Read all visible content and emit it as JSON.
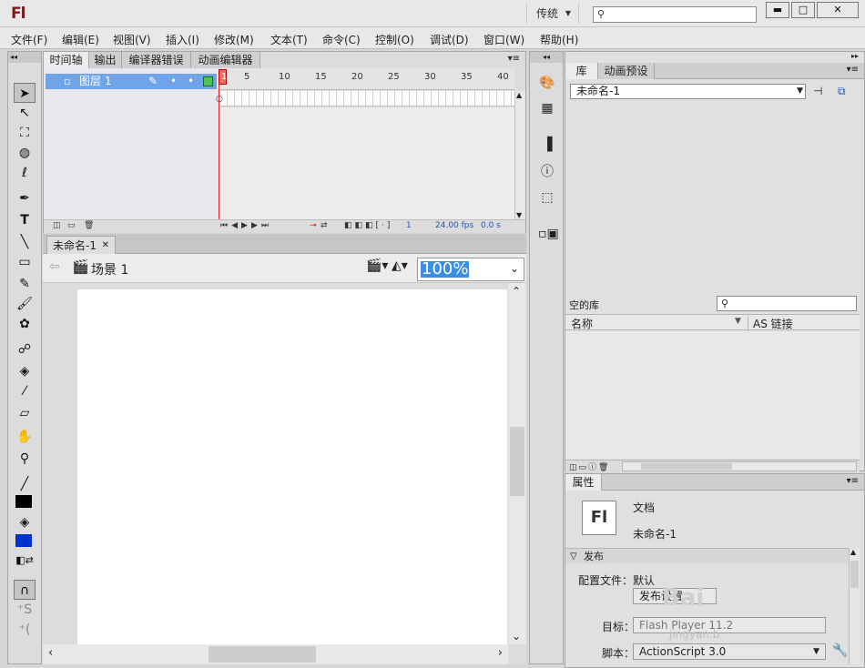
{
  "app": {
    "logo": "Fl",
    "workspace": "传统",
    "search_placeholder": ""
  },
  "window_buttons": [
    "▬",
    "□",
    "✕"
  ],
  "menus": [
    "文件(F)",
    "编辑(E)",
    "视图(V)",
    "插入(I)",
    "修改(M)",
    "文本(T)",
    "命令(C)",
    "控制(O)",
    "调试(D)",
    "窗口(W)",
    "帮助(H)"
  ],
  "timeline": {
    "tabs": [
      "时间轴",
      "输出",
      "编译器错误",
      "动画编辑器"
    ],
    "active_tab": 0,
    "layer_name": "图层 1",
    "ruler_numbers": [
      "1",
      "5",
      "10",
      "15",
      "20",
      "25",
      "30",
      "35",
      "40"
    ],
    "current_frame": "1",
    "fps": "24.00 fps",
    "time": "0.0 s"
  },
  "document": {
    "tab_title": "未命名-1",
    "scene": "场景 1",
    "zoom": "100%"
  },
  "library": {
    "tabs": [
      "库",
      "动画预设"
    ],
    "doc_select": "未命名-1",
    "empty_label": "空的库",
    "col_name": "名称",
    "col_link": "AS 链接"
  },
  "properties": {
    "tab": "属性",
    "doc_type": "文档",
    "doc_name": "未命名-1",
    "publish_section": "发布",
    "profile_label": "配置文件：",
    "profile_value": "默认",
    "publish_settings_button": "发布设置...",
    "target_label": "目标：",
    "target_value": "Flash Player 11.2",
    "script_label": "脚本：",
    "script_value": "ActionScript 3.0"
  },
  "watermark": "Bai",
  "watermark_url": "jingyan.b"
}
